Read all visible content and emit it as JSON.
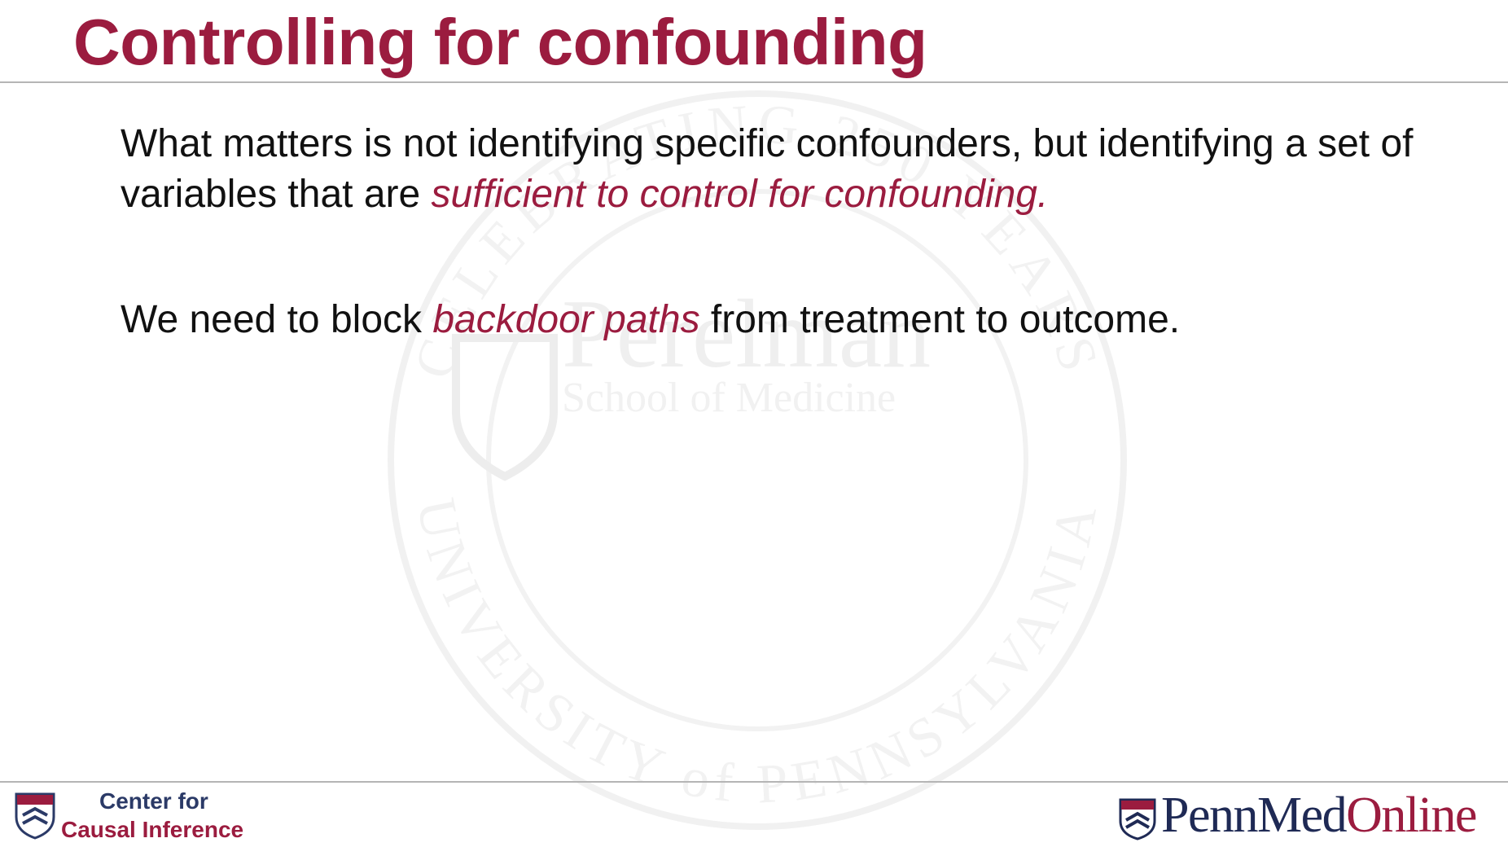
{
  "slide": {
    "title": "Controlling for confounding",
    "paragraph1": {
      "text_before": "What matters is not identifying specific confounders, but identifying a set of variables that are ",
      "emphasis": "sufficient to control for confounding."
    },
    "paragraph2": {
      "text_before": "We need to block ",
      "emphasis": "backdoor paths",
      "text_after": " from treatment to outcome."
    }
  },
  "watermark": {
    "top_arc_text": "CELEBRATING 250 YEARS",
    "bottom_arc_text": "UNIVERSITY of PENNSYLVANIA",
    "name": "Perelman",
    "subname": "School of Medicine"
  },
  "footer": {
    "left_logo": {
      "line1": "Center for",
      "line2": "Causal Inference"
    },
    "right_logo": {
      "part1": "PennMed",
      "part2": "Online"
    }
  },
  "colors": {
    "accent": "#9b1c3f",
    "navy": "#2b3a67",
    "text": "#111111"
  }
}
